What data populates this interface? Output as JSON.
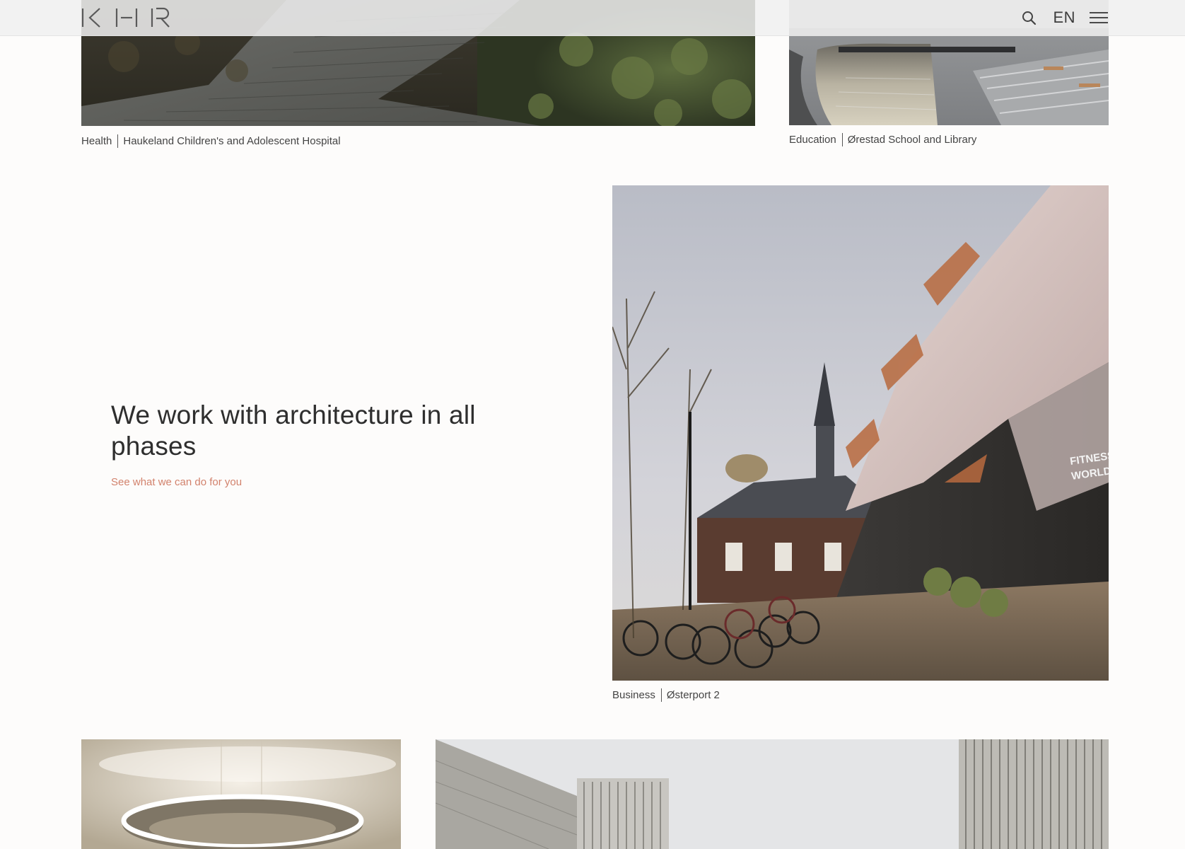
{
  "header": {
    "logo_text": "KHR",
    "language": "EN"
  },
  "projects": [
    {
      "category": "Health",
      "title": "Haukeland Children's and Adolescent Hospital"
    },
    {
      "category": "Education",
      "title": "Ørestad School and Library"
    },
    {
      "category": "Business",
      "title": "Østerport 2"
    },
    {
      "category": "",
      "title": ""
    },
    {
      "category": "",
      "title": ""
    }
  ],
  "intro": {
    "heading": "We work with architecture in all phases",
    "link": "See what we can do for you"
  },
  "colors": {
    "accent": "#d2826c",
    "text": "#3a3a3a",
    "header_bg": "#f0f0f0"
  },
  "icons": [
    "search-icon",
    "menu-icon"
  ]
}
